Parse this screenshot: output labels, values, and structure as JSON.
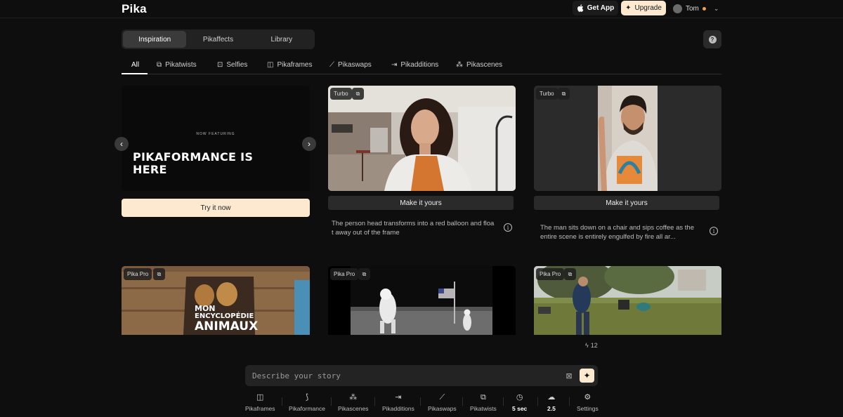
{
  "header": {
    "logo": "Pika",
    "get_app": "Get App",
    "upgrade": "Upgrade",
    "user_name": "Tom"
  },
  "main_tabs": [
    "Inspiration",
    "Pikaffects",
    "Library"
  ],
  "category_tabs": [
    "All",
    "Pikatwists",
    "Selfies",
    "Pikaframes",
    "Pikaswaps",
    "Pikadditions",
    "Pikascenes"
  ],
  "promo": {
    "kicker": "NOW FEATURING",
    "title_line1": "PIKAFORMANCE IS",
    "title_line2": "HERE",
    "cta": "Try it now"
  },
  "cards": [
    {
      "badge": "Turbo",
      "button": "Make it yours",
      "description": "The person head transforms into a red balloon and floa t away out of the frame"
    },
    {
      "badge": "Turbo",
      "button": "Make it yours",
      "description": "The man sits down on a chair and sips coffee as the entire scene is entirely engulfed by fire all ar..."
    },
    {
      "badge": "Pika Pro",
      "book_line1": "MON",
      "book_line2": "ENCYCLOPÉDIE",
      "book_line3": "ANIMAUX"
    },
    {
      "badge": "Pika Pro"
    },
    {
      "badge": "Pika Pro"
    }
  ],
  "credits": "12",
  "prompt": {
    "placeholder": "Describe your story"
  },
  "toolbar": [
    {
      "label": "Pikaframes",
      "icon": "frames-icon"
    },
    {
      "label": "Pikaformance",
      "icon": "performance-icon"
    },
    {
      "label": "Pikascenes",
      "icon": "scenes-icon"
    },
    {
      "label": "Pikadditions",
      "icon": "additions-icon"
    },
    {
      "label": "Pikaswaps",
      "icon": "swaps-icon"
    },
    {
      "label": "Pikatwists",
      "icon": "twists-icon"
    },
    {
      "label": "5 sec",
      "icon": "clock-icon"
    },
    {
      "label": "2.5",
      "icon": "cloud-icon"
    },
    {
      "label": "Settings",
      "icon": "sliders-icon"
    }
  ],
  "colors": {
    "accent": "#fde9d0",
    "background": "#0e0e0e",
    "online_dot": "#f0a24a"
  }
}
